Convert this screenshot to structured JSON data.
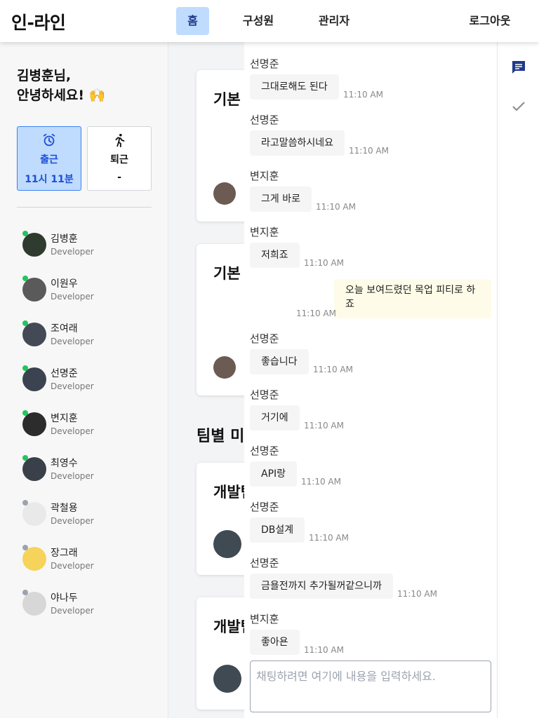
{
  "brand": "인-라인",
  "nav": {
    "home": "홈",
    "members": "구성원",
    "admin": "관리자",
    "logout": "로그아웃"
  },
  "sidebar": {
    "greeting_line1": "김병훈님,",
    "greeting_line2": "안녕하세요! 🙌",
    "clock_in": {
      "label": "출근",
      "time": "11시 11분"
    },
    "clock_out": {
      "label": "퇴근",
      "time": "-"
    },
    "members": [
      {
        "name": "김병훈",
        "role": "Developer",
        "online": true
      },
      {
        "name": "이원우",
        "role": "Developer",
        "online": true
      },
      {
        "name": "조여래",
        "role": "Developer",
        "online": true
      },
      {
        "name": "선명준",
        "role": "Developer",
        "online": true
      },
      {
        "name": "변지훈",
        "role": "Developer",
        "online": true
      },
      {
        "name": "최영수",
        "role": "Developer",
        "online": true
      },
      {
        "name": "곽철용",
        "role": "Developer",
        "online": false
      },
      {
        "name": "장그래",
        "role": "Developer",
        "online": false
      },
      {
        "name": "야나두",
        "role": "Developer",
        "online": false
      }
    ]
  },
  "main": {
    "card1_title": "기본",
    "card2_title": "기본",
    "section_title": "팀별 미",
    "card3_title": "개발팀",
    "card4_title": "개발팀"
  },
  "chat": {
    "messages": [
      {
        "sender": "선명준",
        "text": "그대로해도 된다",
        "time": "11:10 AM"
      },
      {
        "sender": "선명준",
        "text": "라고말씀하시네요",
        "time": "11:10 AM"
      },
      {
        "sender": "변지훈",
        "text": "그게 바로",
        "time": "11:10 AM"
      },
      {
        "sender": "변지훈",
        "text": "저희죠",
        "time": "11:10 AM"
      },
      {
        "sender": "선명준",
        "text": "좋습니다",
        "time": "11:10 AM"
      },
      {
        "sender": "선명준",
        "text": "거기에",
        "time": "11:10 AM"
      },
      {
        "sender": "선명준",
        "text": "API랑",
        "time": "11:10 AM"
      },
      {
        "sender": "선명준",
        "text": "DB설계",
        "time": "11:10 AM"
      },
      {
        "sender": "선명준",
        "text": "금욜전까지 추가될꺼같으니까",
        "time": "11:10 AM"
      },
      {
        "sender": "변지훈",
        "text": "좋아욘",
        "time": "11:10 AM"
      }
    ],
    "my_message": {
      "text": "오늘 보여드렸던 목업 피티로 하죠",
      "time": "11:10 AM"
    },
    "input_placeholder": "채팅하려면 여기에 내용을 입력하세요."
  },
  "rail": {
    "chat_icon": "chat-icon",
    "check_icon": "check-icon"
  },
  "colors": {
    "accent": "#bfdbfe",
    "accent_border": "#3b82f6",
    "online": "#22c55e",
    "offline": "#9ca3af",
    "rail_active": "#1e3a8a"
  }
}
